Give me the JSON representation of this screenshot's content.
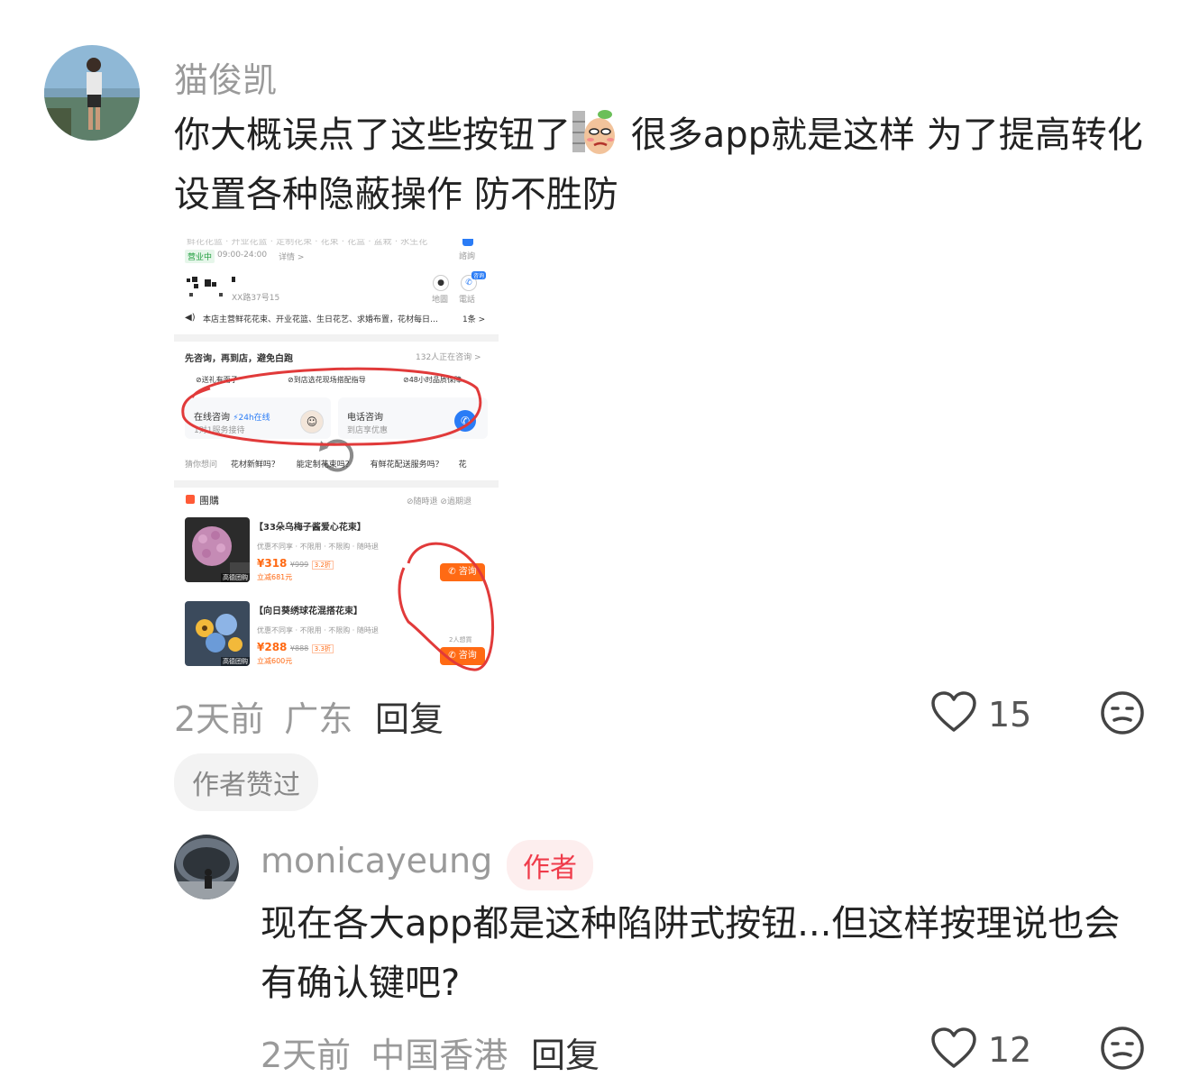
{
  "comment": {
    "username": "猫俊凯",
    "text_before_emoji": "你大概误点了这些按钮了",
    "text_after_emoji": " 很多app就是这样 为了提高转化设置各种隐蔽操作 防不胜防",
    "emoji_icon": "sly-peeking-emoji",
    "time": "2天前",
    "location": "广东",
    "reply_label": "回复",
    "like_count": "15",
    "author_liked_label": "作者赞过"
  },
  "reply": {
    "username": "monicayeung",
    "author_badge": "作者",
    "text": "现在各大app都是这种陷阱式按钮...但这样按理说也会有确认键吧?",
    "time": "2天前",
    "location": "中国香港",
    "reply_label": "回复",
    "like_count": "12"
  },
  "screenshot": {
    "top_fade_text": "鲜花花篮 · 开业花篮 · 定制花束 · 花束 · 花盒 · 盆栽 · 永生花",
    "status_badge": "营业中",
    "hours": "09:00-24:00",
    "detail_link": "详情 >",
    "consult_label": "諮詢",
    "map_label": "地圖",
    "phone_label": "電話",
    "phone_badge": "咨询",
    "address_fragment": "XX路37号15",
    "announcement": "本店主营鲜花花束、开业花篮、生日花艺、求婚布置，花材每日…",
    "announcement_count": "1条 >",
    "consult_header": "先咨询，再到店，避免白跑",
    "consult_count": "132人正在咨询 >",
    "guarantee_1": "送礼有面子",
    "guarantee_2": "到店选花现场搭配指导",
    "guarantee_3": "48小时品质保障",
    "online_title": "在线咨询",
    "online_tag": "24h在线",
    "online_sub": "1对1服务接待",
    "phone_title": "电话咨询",
    "phone_sub": "到店享优惠",
    "question_prefix": "猜你想问",
    "question_1": "花材新鲜吗？",
    "question_2": "能定制花束吗？",
    "question_3": "有鲜花配送服务吗？",
    "question_4": "花",
    "group_title": "團購",
    "group_tag_1": "随時退",
    "group_tag_2": "過期退",
    "product_1": {
      "name": "【33朵乌梅子酱爱心花束】",
      "rules": "优惠不同享 · 不限用 · 不限购 · 随時退",
      "price": "¥318",
      "original": "¥999",
      "discount": "3.2折",
      "saved": "立减681元",
      "img_tag": "高德团购",
      "button": "咨询"
    },
    "product_2": {
      "name": "【向日葵绣球花混搭花束】",
      "rules": "优惠不同享 · 不限用 · 不限购 · 随時退",
      "price": "¥288",
      "original": "¥888",
      "discount": "3.3折",
      "saved": "立减600元",
      "img_tag": "高德团购",
      "want": "2人想買",
      "button": "咨询"
    }
  }
}
